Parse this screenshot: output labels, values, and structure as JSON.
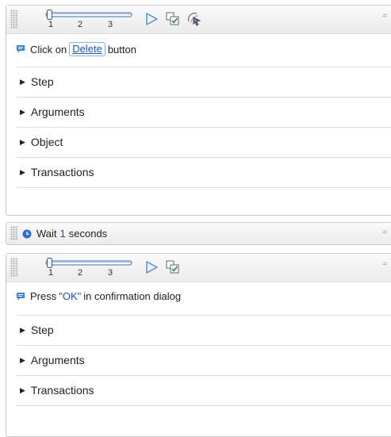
{
  "panel1": {
    "slider": {
      "ticks": [
        "1",
        "2",
        "3"
      ],
      "position": 1
    },
    "description": {
      "prefix": "Click on",
      "object": "Delete",
      "suffix": "button"
    },
    "sections": [
      "Step",
      "Arguments",
      "Object",
      "Transactions"
    ],
    "collapse_symbol": "≈"
  },
  "wait": {
    "prefix": "Wait",
    "value": "1",
    "suffix": "seconds",
    "expand_symbol": "≈"
  },
  "panel3": {
    "slider": {
      "ticks": [
        "1",
        "2",
        "3"
      ],
      "position": 1
    },
    "description": {
      "prefix": "Press",
      "value": "\"OK\"",
      "suffix": "in confirmation dialog"
    },
    "sections": [
      "Step",
      "Arguments",
      "Transactions"
    ],
    "collapse_symbol": "≈"
  },
  "colors": {
    "accent_blue": "#1a4fb0",
    "play_fill": "#e8f1fc",
    "play_stroke": "#5a8fd8",
    "wait_clock": "#2a6fcf",
    "bubble": "#3a86d8"
  },
  "icons": [
    "play-icon",
    "step-check-icon",
    "highlight-object-icon",
    "speech-bubble-icon",
    "clock-icon"
  ]
}
